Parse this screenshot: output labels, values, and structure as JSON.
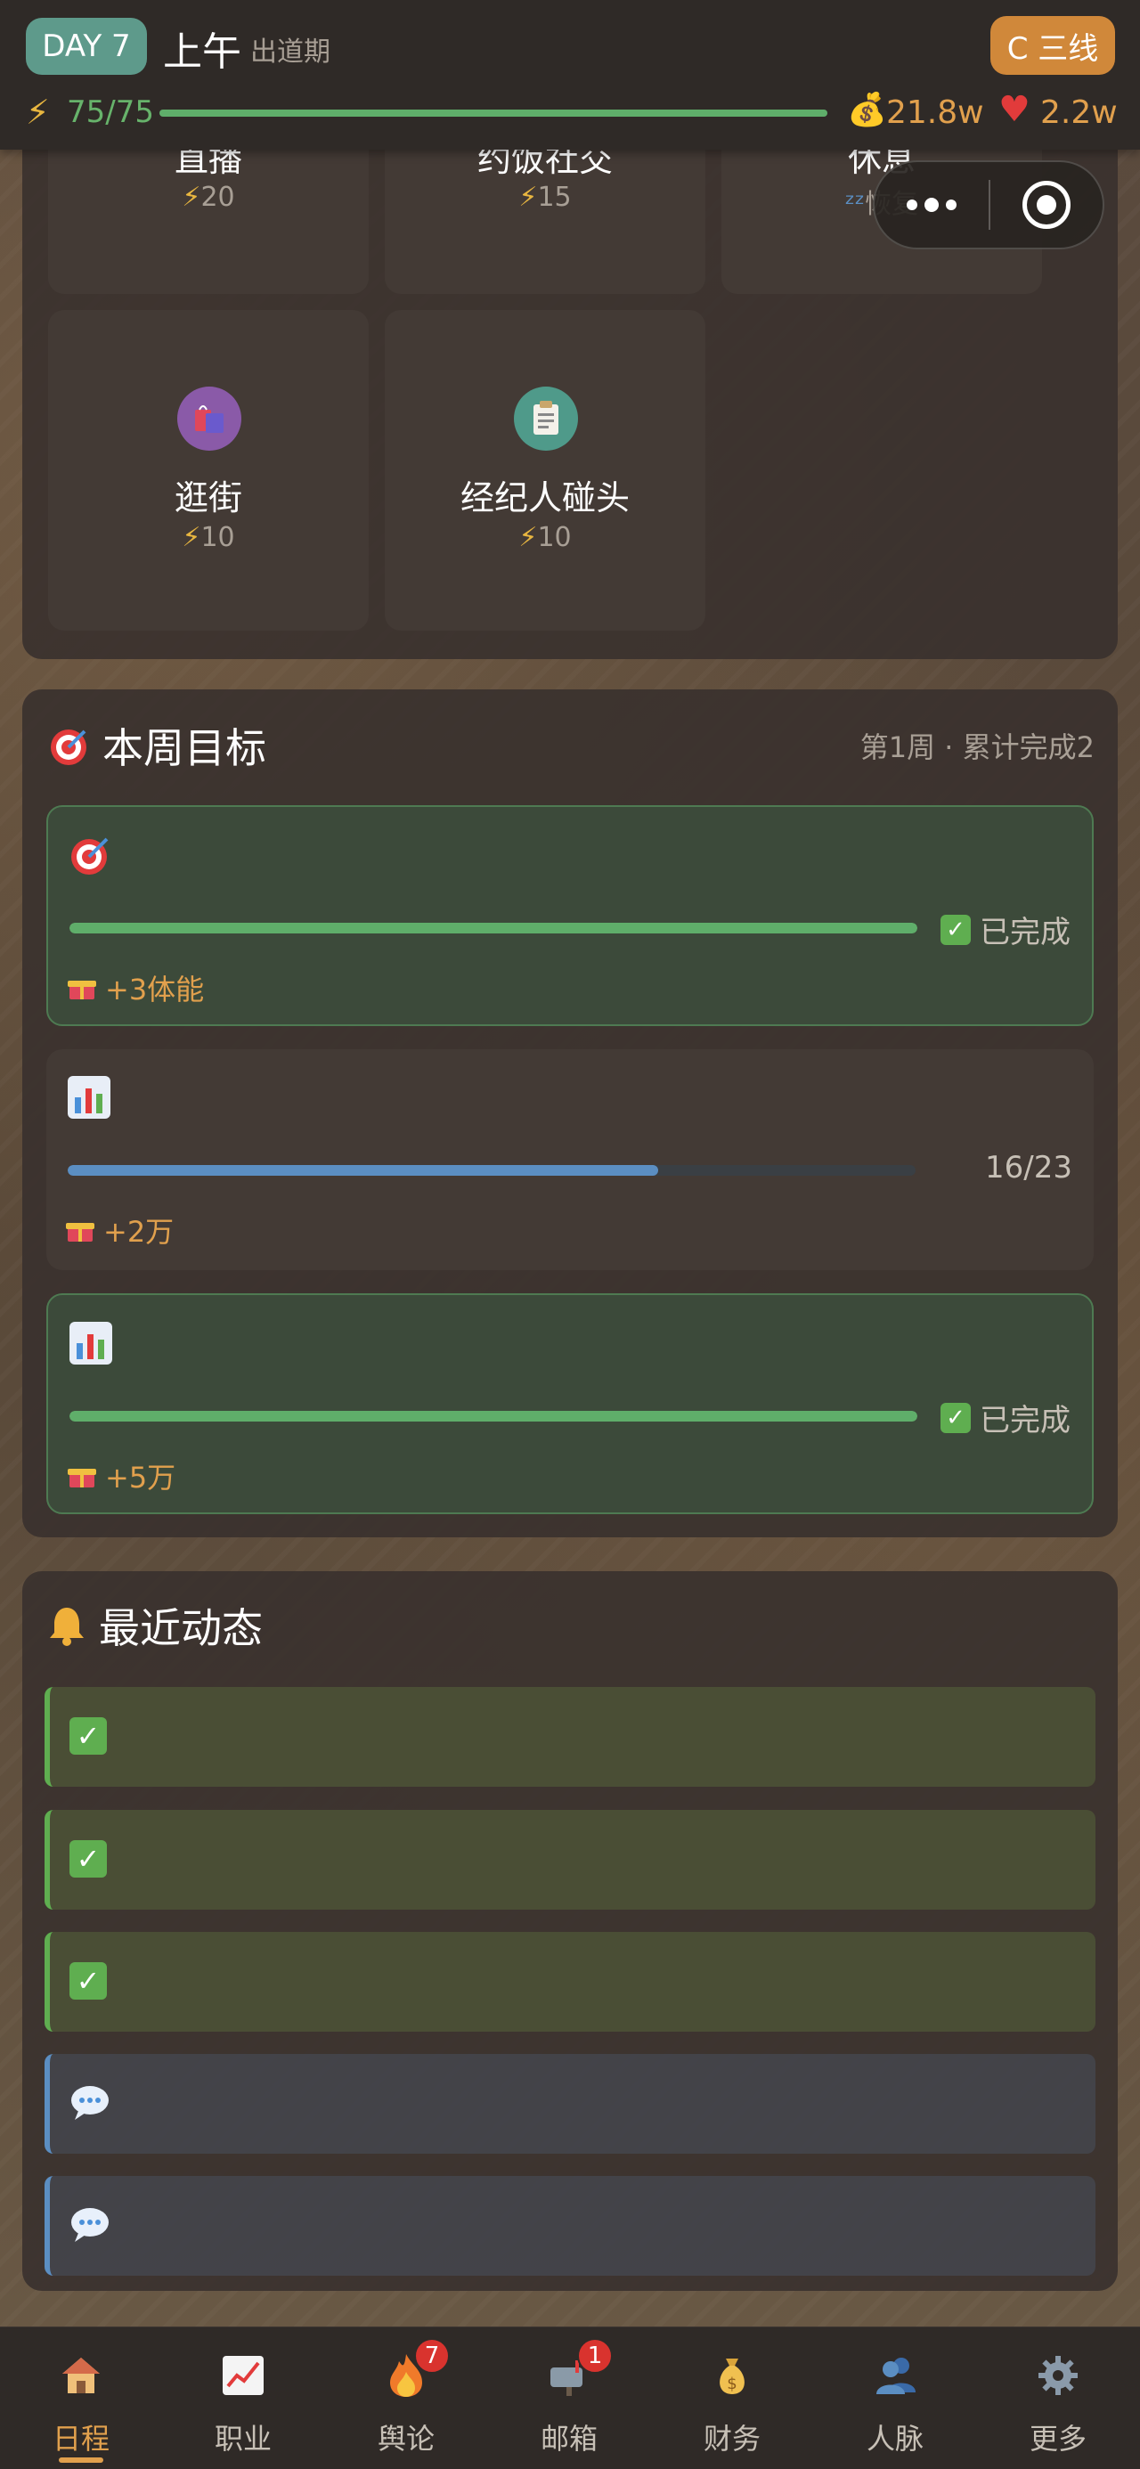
{
  "header": {
    "day": "DAY 7",
    "period": "上午",
    "stage": "出道期",
    "tier": "C 三线",
    "energy": "75/75",
    "energy_fraction": 1.0,
    "money": "21.8w",
    "fans": "2.2w"
  },
  "actions": [
    {
      "name": "直播",
      "cost": "20"
    },
    {
      "name": "约饭社交",
      "cost": "15"
    },
    {
      "name": "休息",
      "cost": "恢复"
    },
    {
      "name": "逛街",
      "cost": "10"
    },
    {
      "name": "经纪人碰头",
      "cost": "10"
    }
  ],
  "weekly_goals": {
    "title": "本周目标",
    "meta": "第1周 · 累计完成2",
    "goals": [
      {
        "icon": "target-icon",
        "status": "已完成",
        "reward": "+3体能",
        "progress": 1.0
      },
      {
        "icon": "bar-chart-icon",
        "status": "16/23",
        "reward": "+2万",
        "progress": 0.696
      },
      {
        "icon": "bar-chart-icon",
        "status": "已完成",
        "reward": "+5万",
        "progress": 1.0
      }
    ]
  },
  "recent": {
    "title": "最近动态"
  },
  "bottom_nav": [
    {
      "label": "日程",
      "icon": "house-icon",
      "badge": ""
    },
    {
      "label": "职业",
      "icon": "trend-chart-icon",
      "badge": ""
    },
    {
      "label": "舆论",
      "icon": "fire-icon",
      "badge": "7"
    },
    {
      "label": "邮箱",
      "icon": "mailbox-icon",
      "badge": "1"
    },
    {
      "label": "财务",
      "icon": "money-bag-icon",
      "badge": ""
    },
    {
      "label": "人脉",
      "icon": "people-icon",
      "badge": ""
    },
    {
      "label": "更多",
      "icon": "gear-icon",
      "badge": ""
    }
  ],
  "colors": {
    "accent": "#e1a04d",
    "success": "#5fae50",
    "progress_blue": "#5b8ec2",
    "day_badge": "#5e9a8b",
    "tier_badge": "#d0883a"
  }
}
